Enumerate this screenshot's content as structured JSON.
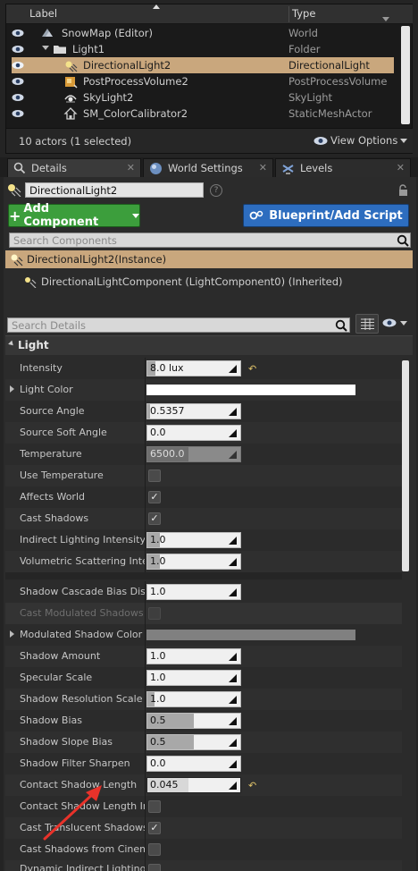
{
  "outliner": {
    "col_label": "Label",
    "col_type": "Type",
    "rows": [
      {
        "label": "SnowMap (Editor)",
        "type": "World",
        "icon": "world-icon"
      },
      {
        "label": "Light1",
        "type": "Folder",
        "icon": "folder-icon"
      },
      {
        "label": "DirectionalLight2",
        "type": "DirectionalLight",
        "icon": "directional-light-icon",
        "selected": true
      },
      {
        "label": "PostProcessVolume2",
        "type": "PostProcessVolume",
        "icon": "postprocess-icon"
      },
      {
        "label": "SkyLight2",
        "type": "SkyLight",
        "icon": "skylight-icon"
      },
      {
        "label": "SM_ColorCalibrator2",
        "type": "StaticMeshActor",
        "icon": "static-mesh-icon"
      }
    ],
    "count_text": "10 actors (1 selected)",
    "view_options": "View Options"
  },
  "tabs": [
    {
      "label": "Details",
      "icon": "details-icon"
    },
    {
      "label": "World Settings",
      "icon": "globe-icon"
    },
    {
      "label": "Levels",
      "icon": "levels-icon"
    }
  ],
  "details": {
    "object_name": "DirectionalLight2",
    "add_component": "Add Component",
    "blueprint": "Blueprint/Add Script",
    "search_components": "Search Components",
    "selected_component": "DirectionalLight2(Instance)",
    "child_component": "DirectionalLightComponent (LightComponent0) (Inherited)",
    "search_details": "Search Details",
    "category": "Light"
  },
  "props": {
    "intensity": {
      "label": "Intensity",
      "value": "8.0 lux"
    },
    "light_color": {
      "label": "Light Color",
      "value": "#ffffff"
    },
    "source_angle": {
      "label": "Source Angle",
      "value": "0.5357"
    },
    "source_soft_angle": {
      "label": "Source Soft Angle",
      "value": "0.0"
    },
    "temperature": {
      "label": "Temperature",
      "value": "6500.0"
    },
    "use_temperature": {
      "label": "Use Temperature",
      "checked": false
    },
    "affects_world": {
      "label": "Affects World",
      "checked": true
    },
    "cast_shadows": {
      "label": "Cast Shadows",
      "checked": true
    },
    "indirect_lighting": {
      "label": "Indirect Lighting Intensity",
      "value": "1.0"
    },
    "volumetric_scattering": {
      "label": "Volumetric Scattering Intensity",
      "value": "1.0"
    },
    "shadow_cascade_bias": {
      "label": "Shadow Cascade Bias Distribution",
      "value": "1.0"
    },
    "cast_modulated": {
      "label": "Cast Modulated Shadows",
      "checked": false
    },
    "modulated_color": {
      "label": "Modulated Shadow Color",
      "value": "#808080"
    },
    "shadow_amount": {
      "label": "Shadow Amount",
      "value": "1.0"
    },
    "specular_scale": {
      "label": "Specular Scale",
      "value": "1.0"
    },
    "shadow_resolution": {
      "label": "Shadow Resolution Scale",
      "value": "1.0"
    },
    "shadow_bias": {
      "label": "Shadow Bias",
      "value": "0.5"
    },
    "shadow_slope_bias": {
      "label": "Shadow Slope Bias",
      "value": "0.5"
    },
    "shadow_filter": {
      "label": "Shadow Filter Sharpen",
      "value": "0.0"
    },
    "contact_shadow_length": {
      "label": "Contact Shadow Length",
      "value": "0.045"
    },
    "contact_shadow_ws": {
      "label": "Contact Shadow Length In World Space Units",
      "checked": false
    },
    "cast_translucent": {
      "label": "Cast Translucent Shadows",
      "checked": true
    },
    "cast_cinematic": {
      "label": "Cast Shadows from Cinematic Objects Only",
      "checked": false
    },
    "dynamic_indirect": {
      "label": "Dynamic Indirect Lighting",
      "checked": false
    }
  },
  "colors": {
    "selection": "#c9a77d",
    "add_component_bg": "#3c9e3c",
    "blueprint_bg": "#2d6dbf",
    "annotation_arrow": "#e8322a"
  }
}
